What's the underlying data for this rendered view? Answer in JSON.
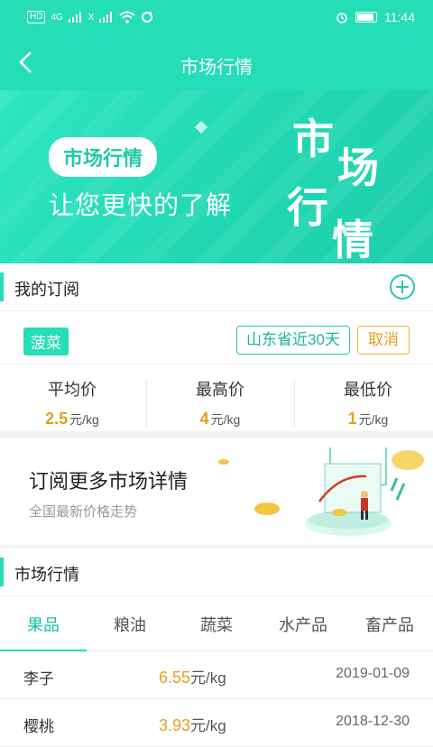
{
  "status_bar": {
    "left_badge": "HD",
    "network": "4G",
    "network2": "X",
    "time": "11:44"
  },
  "header": {
    "title": "市场行情"
  },
  "banner": {
    "pill": "市场行情",
    "subtitle": "让您更快的了解",
    "calligraphy": [
      "市",
      "场",
      "行",
      "情"
    ]
  },
  "subscription": {
    "heading": "我的订阅",
    "item": "菠菜",
    "region_button": "山东省近30天",
    "cancel_button": "取消",
    "prices": [
      {
        "label": "平均价",
        "value": "2.5",
        "unit": "元/kg"
      },
      {
        "label": "最高价",
        "value": "4",
        "unit": "元/kg"
      },
      {
        "label": "最低价",
        "value": "1",
        "unit": "元/kg"
      }
    ]
  },
  "promo": {
    "title": "订阅更多市场详情",
    "subtitle": "全国最新价格走势"
  },
  "market": {
    "heading": "市场行情",
    "tabs": [
      "果品",
      "粮油",
      "蔬菜",
      "水产品",
      "畜产品"
    ],
    "active_tab": 0,
    "rows": [
      {
        "name": "李子",
        "price": "6.55",
        "unit": "元/kg",
        "date": "2019-01-09"
      },
      {
        "name": "樱桃",
        "price": "3.93",
        "unit": "元/kg",
        "date": "2018-12-30"
      }
    ]
  },
  "colors": {
    "accent": "#25ddb7",
    "price": "#e5a020"
  }
}
